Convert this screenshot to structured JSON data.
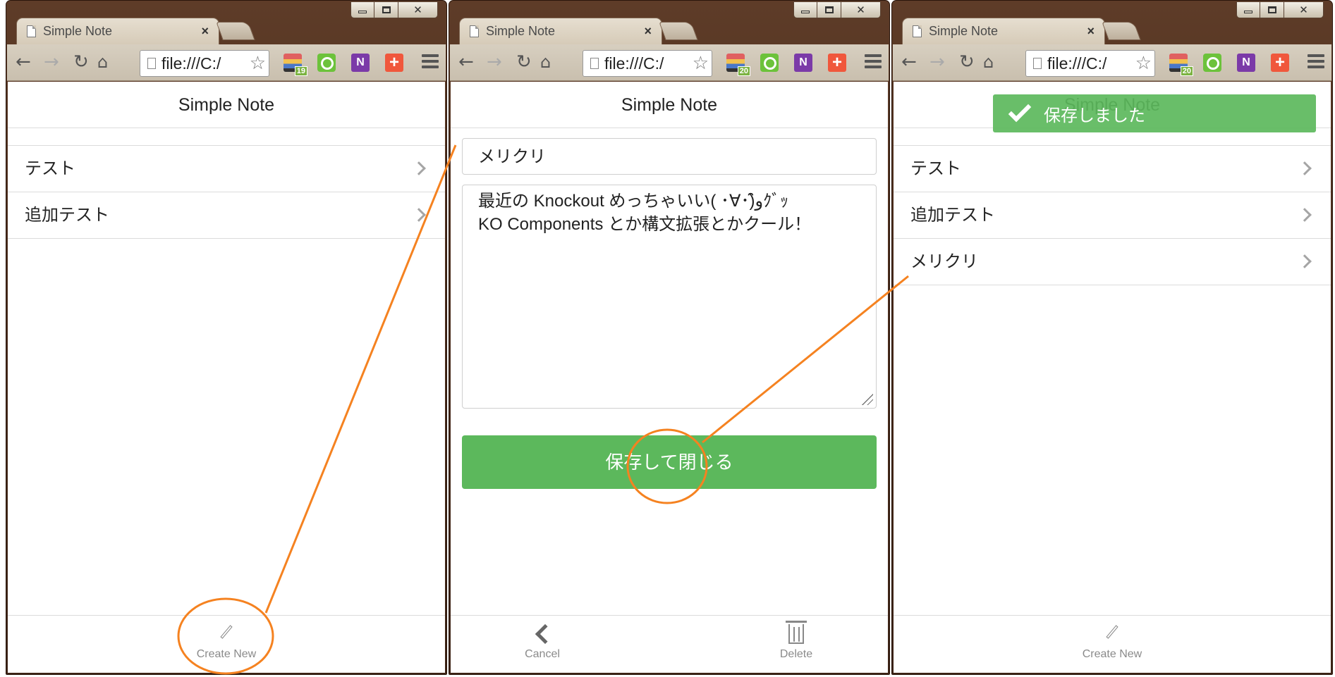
{
  "browser": {
    "tab_title": "Simple Note",
    "tab_close": "×",
    "address": "file:///C:/",
    "badges": {
      "w1": "19",
      "w2": "20",
      "w3": "20"
    },
    "extension_icons": [
      "reading-list-icon",
      "search-extension-icon",
      "onenote-icon",
      "plus-extension-icon"
    ]
  },
  "app": {
    "title": "Simple Note"
  },
  "screen1": {
    "notes": [
      "テスト",
      "追加テスト"
    ],
    "footer_label": "Create New"
  },
  "screen2": {
    "title_value": "メリクリ",
    "body_lines": [
      "最近の Knockout めっちゃいい( ･∀･)ﻭ̑̑ｸﾞｯ",
      "KO Components とか構文拡張とかクール！"
    ],
    "save_button": "保存して閉じる",
    "cancel_label": "Cancel",
    "delete_label": "Delete"
  },
  "screen3": {
    "toast": "保存しました",
    "notes": [
      "テスト",
      "追加テスト",
      "メリクリ"
    ],
    "footer_label": "Create New"
  },
  "colors": {
    "accent_green": "#5cb85c",
    "annotation_orange": "#f58220"
  }
}
